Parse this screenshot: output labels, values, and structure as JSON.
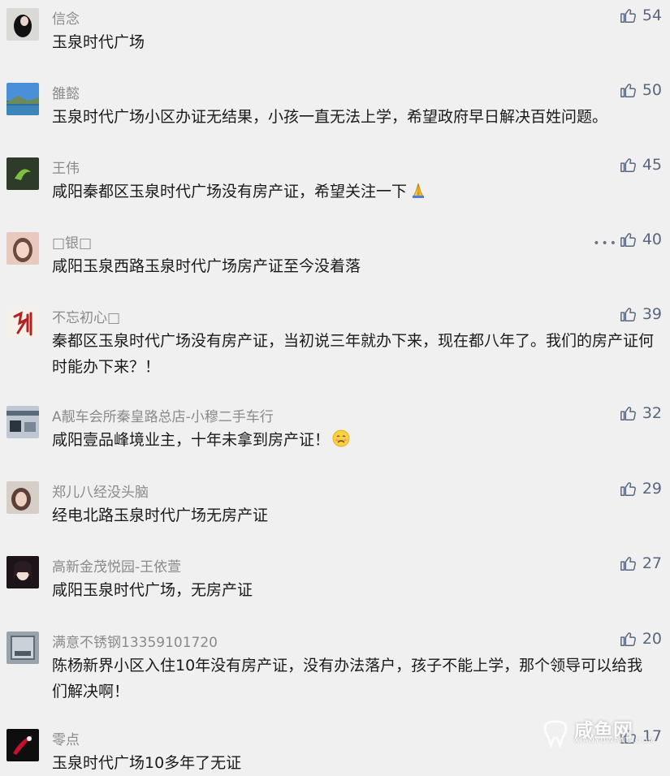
{
  "comments": [
    {
      "name": "信念",
      "text": "玉泉时代广场",
      "likes": "54"
    },
    {
      "name": "雒懿",
      "text": "玉泉时代广场小区办证无结果，小孩一直无法上学，希望政府早日解决百姓问题。",
      "likes": "50"
    },
    {
      "name": "王伟",
      "text": "咸阳秦都区玉泉时代广场没有房产证，希望关注一下",
      "likes": "45",
      "emoji": "folded-hands"
    },
    {
      "name": "□银□",
      "text": "咸阳玉泉西路玉泉时代广场房产证至今没着落",
      "likes": "40",
      "more": "•••"
    },
    {
      "name": "不忘初心□",
      "text": "秦都区玉泉时代广场没有房产证，当初说三年就办下来，现在都八年了。我们的房产证何时能办下来？！",
      "likes": "39"
    },
    {
      "name": "A靓车会所秦皇路总店-小穆二手车行",
      "text": "咸阳壹品峰境业主，十年未拿到房产证！",
      "likes": "32",
      "emoji": "sad-face"
    },
    {
      "name": "郑儿八经没头脑",
      "text": "经电北路玉泉时代广场无房产证",
      "likes": "29"
    },
    {
      "name": "高新金茂悦园-王依萱",
      "text": "咸阳玉泉时代广场，无房产证",
      "likes": "27"
    },
    {
      "name": "满意不锈钢13359101720",
      "text": "陈杨新界小区入住10年没有房产证，没有办法落户，孩子不能上学，那个领导可以给我们解决啊！",
      "likes": "20"
    },
    {
      "name": "零点",
      "text": "玉泉时代广场10多年了无证",
      "likes": "17"
    }
  ],
  "watermark": {
    "title": "咸鱼网",
    "subtitle": "XIANYUWANG.COM"
  }
}
